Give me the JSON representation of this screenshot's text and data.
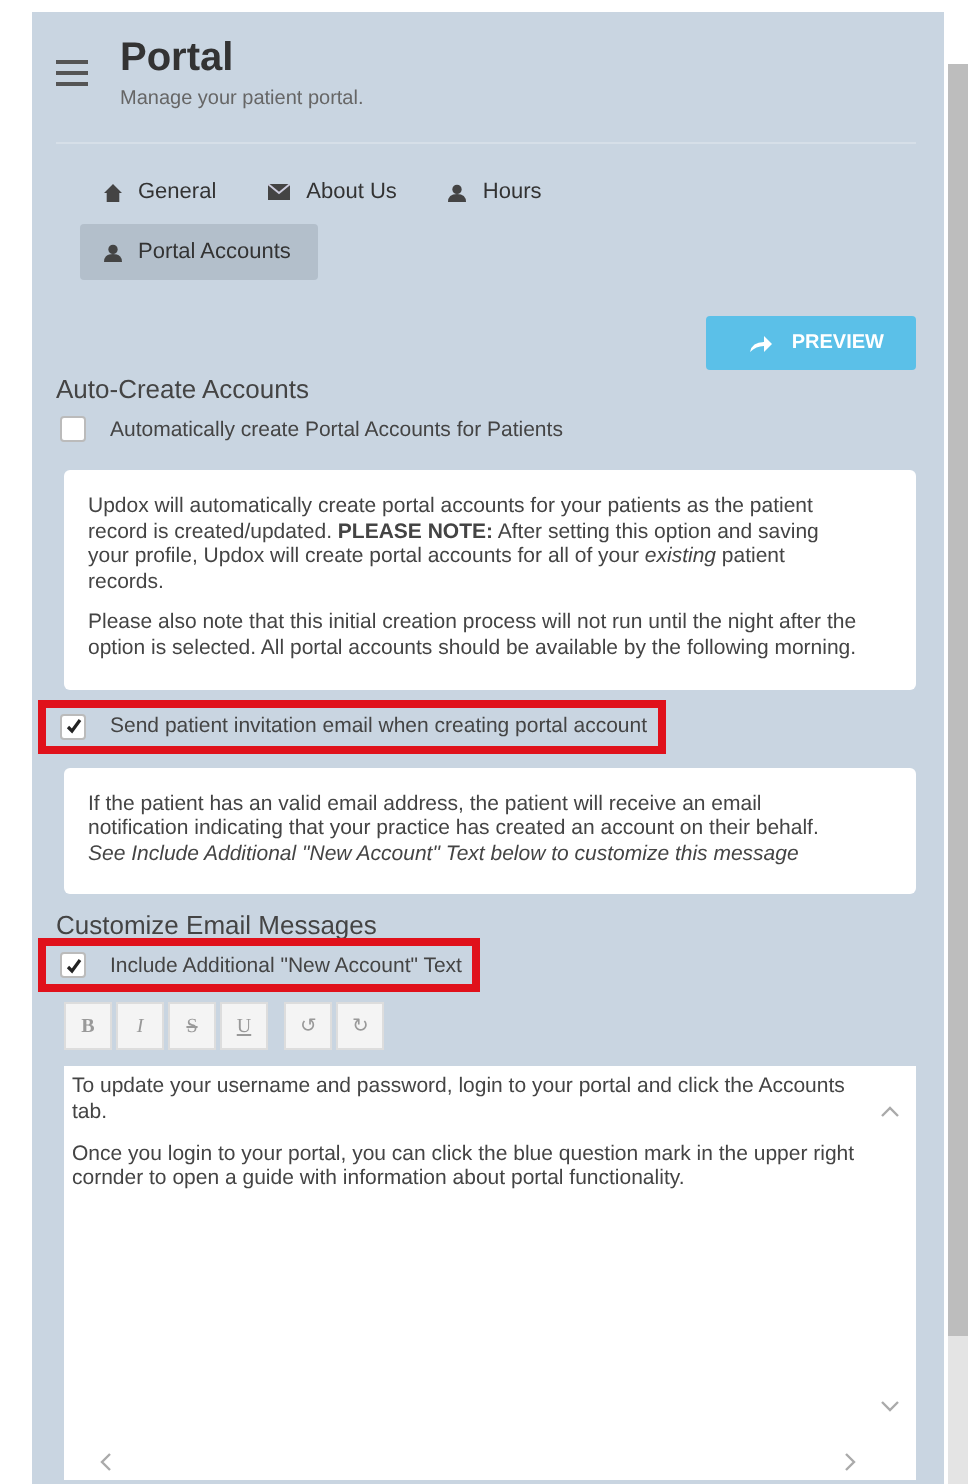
{
  "header": {
    "title": "Portal",
    "subtitle": "Manage your patient portal."
  },
  "tabs": [
    {
      "label": "General",
      "kind": "home",
      "selected": false
    },
    {
      "label": "About Us",
      "kind": "mail",
      "selected": false
    },
    {
      "label": "Hours",
      "kind": "user",
      "selected": false
    },
    {
      "label": "Portal Accounts",
      "kind": "user",
      "selected": true
    }
  ],
  "preview_button": {
    "label": "PREVIEW"
  },
  "auto_create": {
    "heading": "Auto-Create Accounts",
    "checkbox": {
      "label": "Automatically create Portal Accounts for Patients",
      "checked": false,
      "highlighted": false
    },
    "info": [
      {
        "text": "Updox will automatically create portal accounts for your patients as the patient record is created/updated. **PLEASE NOTE:** After setting this option and saving your profile, Updox will create portal accounts for all of your *existing* patient records.",
        "italic": false
      },
      {
        "text": "Please also note that this initial creation process will not run until the night after the option is selected. All portal accounts should be available by the following morning.",
        "italic": false
      }
    ]
  },
  "invitation": {
    "checkbox": {
      "label": "Send patient invitation email when creating portal account",
      "checked": true,
      "highlighted": true
    },
    "info": [
      {
        "text": "If the patient has an valid email address, the patient will receive an email notification indicating that your practice has created an account on their behalf.",
        "italic": false
      },
      {
        "text": "See Include Additional \"New Account\" Text below to customize this message",
        "italic": true
      }
    ]
  },
  "customize": {
    "heading": "Customize Email Messages",
    "checkbox": {
      "label": "Include Additional \"New Account\" Text",
      "checked": true,
      "highlighted": true
    },
    "toolbar": [
      [
        {
          "label": "B",
          "kind": "bold"
        },
        {
          "label": "I",
          "kind": "italic"
        },
        {
          "label": "S",
          "kind": "strike"
        },
        {
          "label": "U",
          "kind": "underline"
        }
      ],
      [
        {
          "label": "↺",
          "kind": "undo"
        },
        {
          "label": "↻",
          "kind": "redo"
        }
      ]
    ],
    "editor": [
      "To update your username and password, login to your portal and click the Accounts tab.",
      "Once you login to your portal, you can click the blue question mark in the upper right cornder to open a guide with information about portal functionality."
    ]
  }
}
